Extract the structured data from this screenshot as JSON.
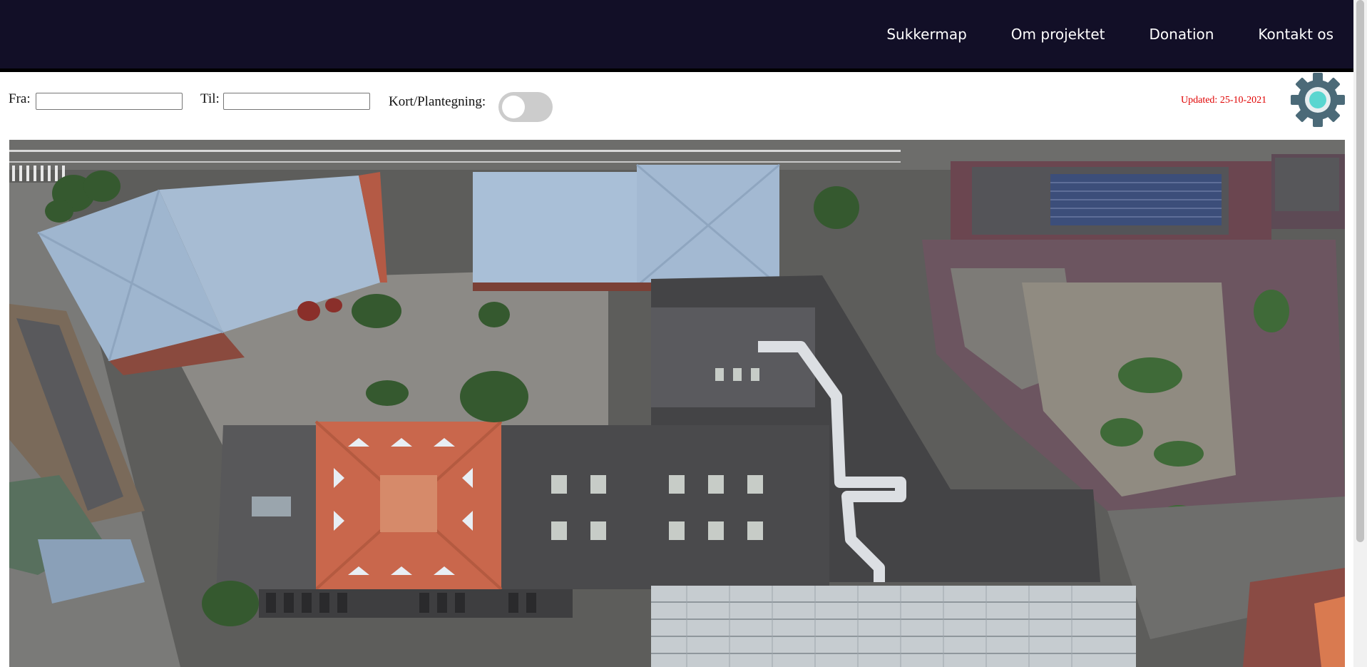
{
  "nav": {
    "items": [
      "Sukkermap",
      "Om projektet",
      "Donation",
      "Kontakt os"
    ]
  },
  "controls": {
    "from_label": "Fra:",
    "from_value": "",
    "to_label": "Til:",
    "to_value": "",
    "toggle_label": "Kort/Plantegning:",
    "toggle_on": false
  },
  "status": {
    "updated": "Updated: 25-10-2021"
  },
  "icons": {
    "settings": "gear-icon"
  },
  "colors": {
    "header_bg": "#120f27",
    "nav_text": "#ffffff",
    "updated_text": "#e00000",
    "gear_body": "#4b6a78",
    "gear_center": "#5ad6d0"
  }
}
